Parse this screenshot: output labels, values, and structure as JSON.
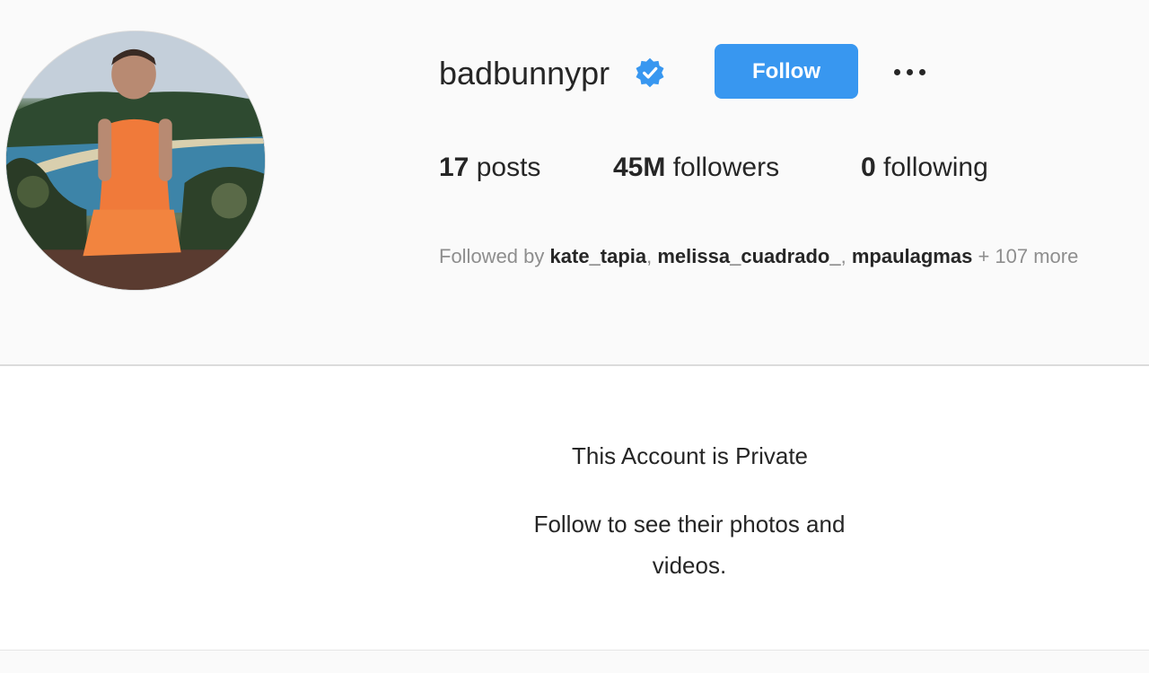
{
  "profile": {
    "username": "badbunnypr",
    "verified_icon": "verified-badge-icon",
    "follow_label": "Follow",
    "more_icon": "more-options-icon",
    "accent_color": "#3897f0"
  },
  "stats": {
    "posts": {
      "count": "17",
      "label": "posts"
    },
    "followers": {
      "count": "45M",
      "label": "followers"
    },
    "following": {
      "count": "0",
      "label": "following"
    }
  },
  "followed_by": {
    "prefix": "Followed by ",
    "users": [
      "kate_tapia",
      "melissa_cuadrado_",
      "mpaulagmas"
    ],
    "separator": ", ",
    "suffix": " + 107 more"
  },
  "private": {
    "title": "This Account is Private",
    "subtitle": "Follow to see their photos and videos."
  }
}
